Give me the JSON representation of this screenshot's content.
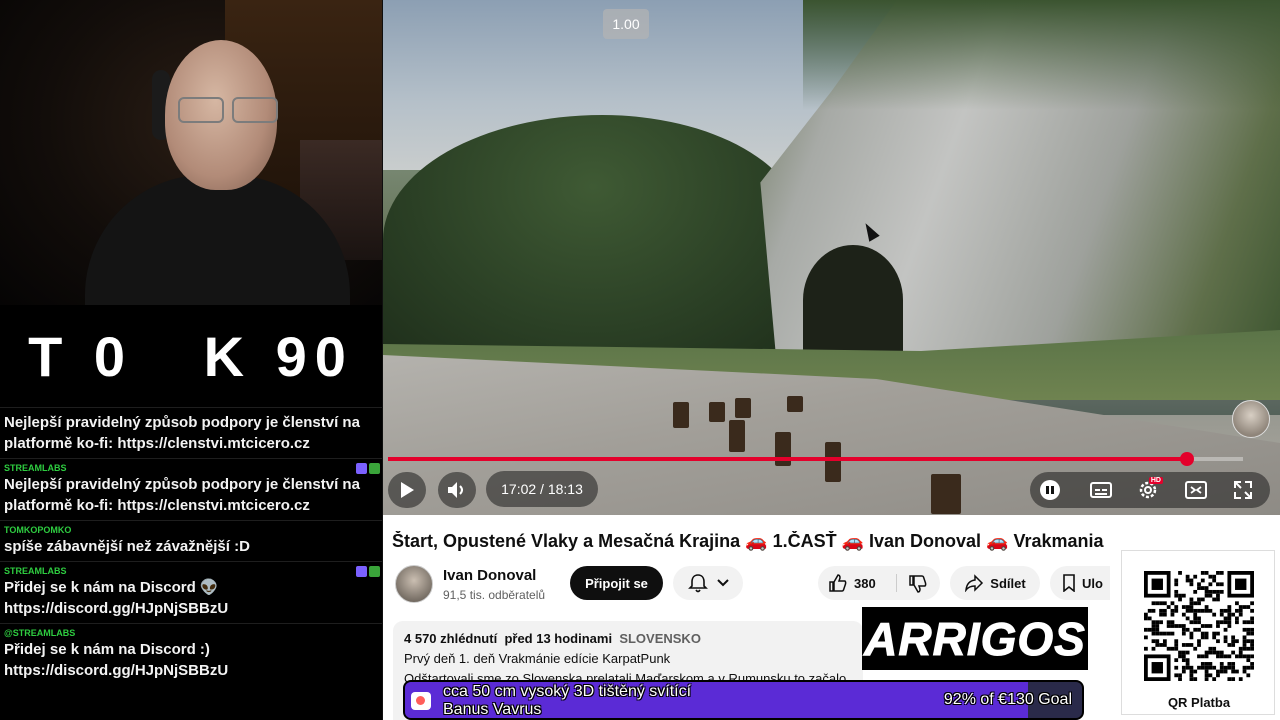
{
  "overlay_title": "T 0   K 90",
  "chat": {
    "messages": [
      {
        "user": "",
        "text": "Nejlepší pravidelný způsob podpory je členství na platformě ko-fi: https://clenstvi.mtcicero.cz"
      },
      {
        "user": "STREAMLABS",
        "text": "Nejlepší pravidelný způsob podpory je členství na platformě ko-fi: https://clenstvi.mtcicero.cz"
      },
      {
        "user": "TOMKOPOMKO",
        "text": "spíše zábavnější než závažnější :D"
      },
      {
        "user": "STREAMLABS",
        "text": "Přidej se k nám na Discord 👽 https://discord.gg/HJpNjSBBzU"
      },
      {
        "user": "@STREAMLABS",
        "text": "Přidej se k nám na Discord :) https://discord.gg/HJpNjSBBzU"
      }
    ],
    "badge_colors": [
      "#7b61ff",
      "#3aa43a"
    ]
  },
  "player": {
    "speed_label": "1.00",
    "time_display": "17:02 / 18:13",
    "progress": 0.935,
    "hd_badge": "HD",
    "accent": "#e4002b",
    "icons": [
      "play-icon",
      "volume-icon",
      "pause-toggle-icon",
      "subtitles-icon",
      "settings-icon",
      "miniplayer-icon",
      "fullscreen-icon"
    ]
  },
  "video_info": {
    "title_parts": [
      "Štart, Opustené Vlaky a Mesačná Krajina ",
      "🚗",
      " 1.ČASŤ ",
      "🚗",
      " Ivan Donoval ",
      "🚗",
      " Vrakmania"
    ],
    "channel_name": "Ivan Donoval",
    "subscribers": "91,5 tis. odběratelů",
    "join_label": "Připojit se",
    "like_count": "380",
    "share_label": "Sdílet",
    "save_label": "Ulo",
    "views": "4 570 zhlédnutí",
    "time_ago": "před 13 hodinami",
    "tag": "SLOVENSKO",
    "desc_line1": "Prvý deň 1. deň Vrakmánie edície KarpatPunk",
    "desc_line2": "Odštartovali sme zo Slovenska prelatali Maďarskom a v Rumunsku to začalo"
  },
  "sponsor": {
    "brand": "ARRIGOS"
  },
  "qr": {
    "label": "QR Platba"
  },
  "goal": {
    "line1": "cca 50 cm vysoký 3D tištěný svítící",
    "line2": "Banus Vavrus",
    "progress_text": "92% of €130 Goal",
    "progress": 0.92,
    "fill_color": "#5b2bd6"
  }
}
